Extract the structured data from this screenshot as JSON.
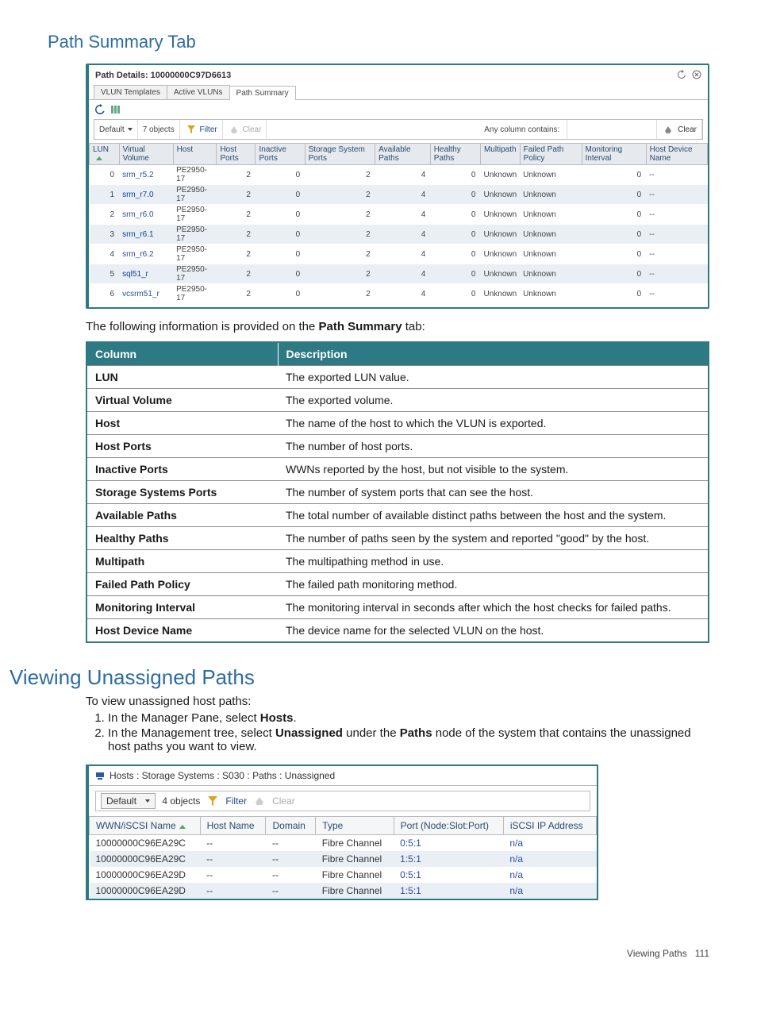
{
  "headings": {
    "path_summary": "Path Summary Tab",
    "viewing_unassigned": "Viewing Unassigned Paths"
  },
  "path_details": {
    "title": "Path Details: 10000000C97D6613",
    "tabs": [
      "VLUN Templates",
      "Active VLUNs",
      "Path Summary"
    ],
    "active_tab": "Path Summary",
    "toolbar": {
      "view": "Default",
      "object_count": "7 objects",
      "filter": "Filter",
      "clear_disabled": "Clear",
      "any_column": "Any column contains:",
      "clear": "Clear"
    },
    "columns": [
      "LUN",
      "Virtual Volume",
      "Host",
      "Host Ports",
      "Inactive Ports",
      "Storage System Ports",
      "Available Paths",
      "Healthy Paths",
      "Multipath",
      "Failed Path Policy",
      "Monitoring Interval",
      "Host Device Name"
    ],
    "rows": [
      {
        "lun": "0",
        "vv": "srm_r5.2",
        "host": "PE2950-17",
        "hp": "2",
        "ip": "0",
        "sp": "2",
        "ap": "4",
        "hlp": "0",
        "mp": "Unknown",
        "fpp": "Unknown",
        "mi": "0",
        "hdn": "--"
      },
      {
        "lun": "1",
        "vv": "srm_r7.0",
        "host": "PE2950-17",
        "hp": "2",
        "ip": "0",
        "sp": "2",
        "ap": "4",
        "hlp": "0",
        "mp": "Unknown",
        "fpp": "Unknown",
        "mi": "0",
        "hdn": "--"
      },
      {
        "lun": "2",
        "vv": "srm_r6.0",
        "host": "PE2950-17",
        "hp": "2",
        "ip": "0",
        "sp": "2",
        "ap": "4",
        "hlp": "0",
        "mp": "Unknown",
        "fpp": "Unknown",
        "mi": "0",
        "hdn": "--"
      },
      {
        "lun": "3",
        "vv": "srm_r6.1",
        "host": "PE2950-17",
        "hp": "2",
        "ip": "0",
        "sp": "2",
        "ap": "4",
        "hlp": "0",
        "mp": "Unknown",
        "fpp": "Unknown",
        "mi": "0",
        "hdn": "--"
      },
      {
        "lun": "4",
        "vv": "srm_r6.2",
        "host": "PE2950-17",
        "hp": "2",
        "ip": "0",
        "sp": "2",
        "ap": "4",
        "hlp": "0",
        "mp": "Unknown",
        "fpp": "Unknown",
        "mi": "0",
        "hdn": "--"
      },
      {
        "lun": "5",
        "vv": "sql51_r",
        "host": "PE2950-17",
        "hp": "2",
        "ip": "0",
        "sp": "2",
        "ap": "4",
        "hlp": "0",
        "mp": "Unknown",
        "fpp": "Unknown",
        "mi": "0",
        "hdn": "--"
      },
      {
        "lun": "6",
        "vv": "vcsrm51_r",
        "host": "PE2950-17",
        "hp": "2",
        "ip": "0",
        "sp": "2",
        "ap": "4",
        "hlp": "0",
        "mp": "Unknown",
        "fpp": "Unknown",
        "mi": "0",
        "hdn": "--"
      }
    ]
  },
  "intro_text": {
    "prefix": "The following information is provided on the ",
    "bold": "Path Summary",
    "suffix": " tab:"
  },
  "desc_table": {
    "headers": [
      "Column",
      "Description"
    ],
    "rows": [
      [
        "LUN",
        "The exported LUN value."
      ],
      [
        "Virtual Volume",
        "The exported volume."
      ],
      [
        "Host",
        "The name of the host to which the VLUN is exported."
      ],
      [
        "Host Ports",
        "The number of host ports."
      ],
      [
        "Inactive Ports",
        "WWNs reported by the host, but not visible to the system."
      ],
      [
        "Storage Systems Ports",
        "The number of system ports that can see the host."
      ],
      [
        "Available Paths",
        "The total number of available distinct paths between the host and the system."
      ],
      [
        "Healthy Paths",
        "The number of paths seen by the system and reported \"good\" by the host."
      ],
      [
        "Multipath",
        "The multipathing method in use."
      ],
      [
        "Failed Path Policy",
        "The failed path monitoring method."
      ],
      [
        "Monitoring Interval",
        "The monitoring interval in seconds after which the host checks for failed paths."
      ],
      [
        "Host Device Name",
        "The device name for the selected VLUN on the host."
      ]
    ]
  },
  "procedure": {
    "lead": "To view unassigned host paths:",
    "steps": [
      {
        "pre": "In the Manager Pane, select ",
        "b1": "Hosts",
        "post": "."
      },
      {
        "pre": "In the Management tree, select ",
        "b1": "Unassigned",
        "mid": " under the ",
        "b2": "Paths",
        "post": " node of the system that contains the unassigned host paths you want to view."
      }
    ]
  },
  "unassigned": {
    "breadcrumb": "Hosts : Storage Systems : S030 : Paths : Unassigned",
    "view": "Default",
    "object_count": "4 objects",
    "filter": "Filter",
    "clear": "Clear",
    "columns": [
      "WWN/iSCSI Name",
      "Host Name",
      "Domain",
      "Type",
      "Port (Node:Slot:Port)",
      "iSCSI IP Address"
    ],
    "rows": [
      {
        "w": "10000000C96EA29C",
        "h": "--",
        "d": "--",
        "t": "Fibre Channel",
        "p": "0:5:1",
        "ip": "n/a"
      },
      {
        "w": "10000000C96EA29C",
        "h": "--",
        "d": "--",
        "t": "Fibre Channel",
        "p": "1:5:1",
        "ip": "n/a"
      },
      {
        "w": "10000000C96EA29D",
        "h": "--",
        "d": "--",
        "t": "Fibre Channel",
        "p": "0:5:1",
        "ip": "n/a"
      },
      {
        "w": "10000000C96EA29D",
        "h": "--",
        "d": "--",
        "t": "Fibre Channel",
        "p": "1:5:1",
        "ip": "n/a"
      }
    ]
  },
  "footer": {
    "section": "Viewing Paths",
    "page": "111"
  }
}
